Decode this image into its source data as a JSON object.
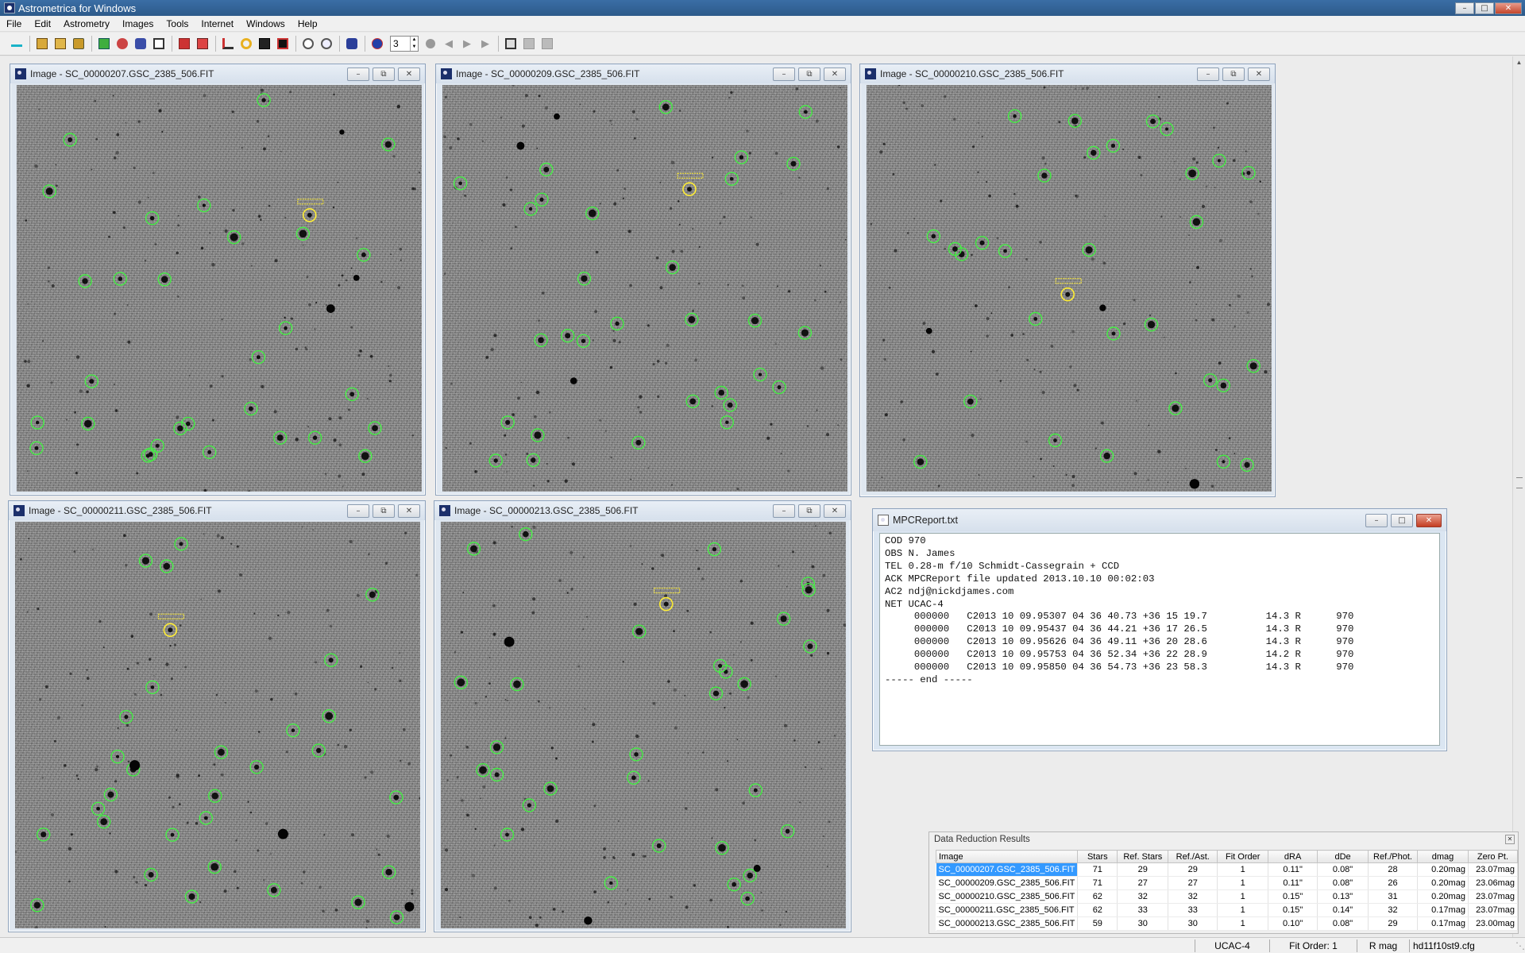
{
  "app": {
    "title": "Astrometrica for Windows"
  },
  "menu": [
    "File",
    "Edit",
    "Astrometry",
    "Images",
    "Tools",
    "Internet",
    "Windows",
    "Help"
  ],
  "toolbar": {
    "buttons": [
      "connect-icon",
      "open-images-icon",
      "open-folder-icon",
      "load-icon",
      "add-icon",
      "settings-icon",
      "catalog-icon",
      "blink-icon",
      "delete-icon",
      "clear-icon",
      "measure-icon",
      "aperture-icon",
      "edit-icon",
      "stack-icon",
      "zoom-in-icon",
      "zoom-out-icon",
      "track-icon",
      "globe-icon"
    ],
    "spin_value": "3",
    "media": [
      "record-icon",
      "first-icon",
      "play-icon",
      "next-icon"
    ],
    "extra": [
      "frame-icon",
      "grid-a-icon",
      "grid-b-icon"
    ]
  },
  "images": [
    {
      "title": "Image - SC_00000207.GSC_2385_506.FIT"
    },
    {
      "title": "Image - SC_00000209.GSC_2385_506.FIT"
    },
    {
      "title": "Image - SC_00000210.GSC_2385_506.FIT"
    },
    {
      "title": "Image - SC_00000211.GSC_2385_506.FIT"
    },
    {
      "title": "Image - SC_00000213.GSC_2385_506.FIT"
    }
  ],
  "report": {
    "title": "MPCReport.txt",
    "text": "COD 970\nOBS N. James\nTEL 0.28-m f/10 Schmidt-Cassegrain + CCD\nACK MPCReport file updated 2013.10.10 00:02:03\nAC2 ndj@nickdjames.com\nNET UCAC-4\n     000000   C2013 10 09.95307 04 36 40.73 +36 15 19.7          14.3 R      970\n     000000   C2013 10 09.95437 04 36 44.21 +36 17 26.5          14.3 R      970\n     000000   C2013 10 09.95626 04 36 49.11 +36 20 28.6          14.3 R      970\n     000000   C2013 10 09.95753 04 36 52.34 +36 22 28.9          14.2 R      970\n     000000   C2013 10 09.95850 04 36 54.73 +36 23 58.3          14.3 R      970\n----- end -----"
  },
  "drr": {
    "title": "Data Reduction Results",
    "columns": [
      "Image",
      "Stars",
      "Ref. Stars",
      "Ref./Ast.",
      "Fit Order",
      "dRA",
      "dDe",
      "Ref./Phot.",
      "dmag",
      "Zero Pt."
    ],
    "rows": [
      [
        "SC_00000207.GSC_2385_506.FIT",
        "71",
        "29",
        "29",
        "1",
        "0.11\"",
        "0.08\"",
        "28",
        "0.20mag",
        "23.07mag"
      ],
      [
        "SC_00000209.GSC_2385_506.FIT",
        "71",
        "27",
        "27",
        "1",
        "0.11\"",
        "0.08\"",
        "26",
        "0.20mag",
        "23.06mag"
      ],
      [
        "SC_00000210.GSC_2385_506.FIT",
        "62",
        "32",
        "32",
        "1",
        "0.15\"",
        "0.13\"",
        "31",
        "0.20mag",
        "23.07mag"
      ],
      [
        "SC_00000211.GSC_2385_506.FIT",
        "62",
        "33",
        "33",
        "1",
        "0.15\"",
        "0.14\"",
        "32",
        "0.17mag",
        "23.07mag"
      ],
      [
        "SC_00000213.GSC_2385_506.FIT",
        "59",
        "30",
        "30",
        "1",
        "0.10\"",
        "0.08\"",
        "29",
        "0.17mag",
        "23.00mag"
      ]
    ]
  },
  "status": {
    "catalog": "UCAC-4",
    "fit_order": "Fit Order: 1",
    "mag": "R mag",
    "config": "hd11f10st9.cfg"
  },
  "colors": {
    "ref_star": "#44ee44",
    "target": "#ffee33",
    "selection": "#3399ff",
    "titlebar": "#3a6ea5"
  }
}
